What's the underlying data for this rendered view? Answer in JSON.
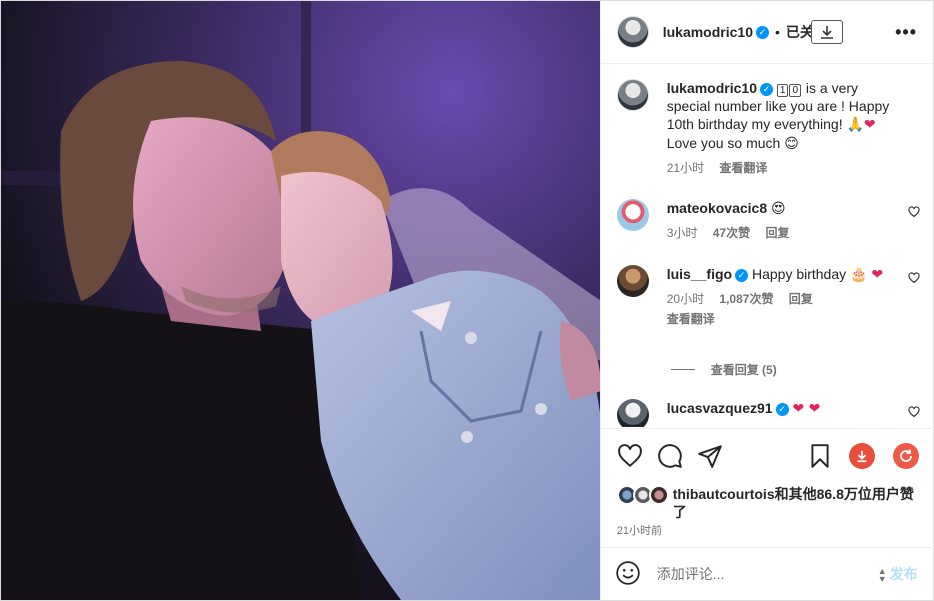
{
  "post": {
    "author": "lukamodric10",
    "follow_state": "已关注",
    "separator": "•"
  },
  "caption": {
    "user": "lukamodric10",
    "keycap_1": "1",
    "keycap_0": "0",
    "text": " is a very special number like you are ! Happy 10th birthday my everything! ",
    "text_end": " Love you so much ",
    "emoji_pray": "🙏",
    "emoji_heart": "❤",
    "emoji_smile": "😊",
    "time": "21小时",
    "translate": "查看翻译"
  },
  "comments": [
    {
      "user": "mateokovacic8",
      "emoji": "😍",
      "time": "3小时",
      "likes": "47次赞",
      "reply": "回复"
    },
    {
      "user": "luis__figo",
      "text": "Happy birthday ",
      "emoji": "🎂",
      "emoji2": "❤",
      "time": "20小时",
      "likes": "1,087次赞",
      "reply": "回复",
      "translate": "查看翻译",
      "view_replies": "查看回复 (5)"
    },
    {
      "user": "lucasvazquez91",
      "emoji": "❤ ❤"
    }
  ],
  "likes": {
    "text": "thibautcourtois和其他86.8万位用户赞了"
  },
  "timestamp": "21小时前",
  "composer": {
    "placeholder": "添加评论...",
    "post_label": "发布"
  },
  "colors": {
    "link_blue": "#0095f6",
    "download_red": "#e94e3c",
    "refresh_red": "#ee5a48"
  }
}
